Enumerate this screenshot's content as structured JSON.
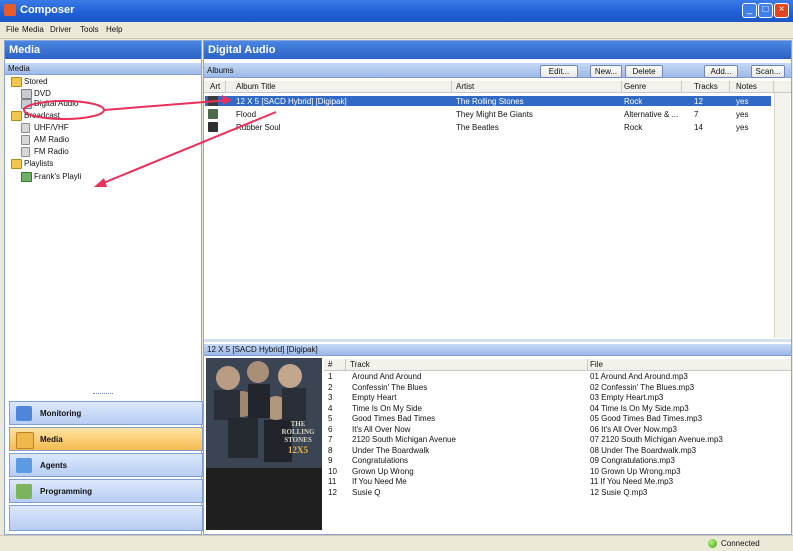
{
  "window": {
    "title": "Composer"
  },
  "menu": [
    "File",
    "Media",
    "Driver",
    "Tools",
    "Help"
  ],
  "left": {
    "header": "Media",
    "subheader": "Media",
    "tree": [
      {
        "label": "Stored",
        "icon": "folder-icon"
      },
      {
        "label": "DVD",
        "icon": "dvd-device-icon"
      },
      {
        "label": "Digital Audio",
        "icon": "digital-audio-device-icon"
      },
      {
        "label": "Broadcast",
        "icon": "folder-icon"
      },
      {
        "label": "UHF/VHF",
        "icon": "antenna-icon"
      },
      {
        "label": "AM Radio",
        "icon": "radio-icon"
      },
      {
        "label": "FM Radio",
        "icon": "radio-icon"
      },
      {
        "label": "Playlists",
        "icon": "folder-icon"
      },
      {
        "label": "Frank's Playli",
        "icon": "playlist-icon"
      }
    ],
    "nav": [
      {
        "label": "Monitoring",
        "active": false
      },
      {
        "label": "Media",
        "active": true
      },
      {
        "label": "Agents",
        "active": false
      },
      {
        "label": "Programming",
        "active": false
      }
    ]
  },
  "right": {
    "header": "Digital Audio",
    "albums_label": "Albums",
    "toolbar": {
      "edit": "Edit...",
      "new": "New...",
      "delete": "Delete",
      "add": "Add...",
      "scan": "Scan..."
    },
    "columns": [
      "Art",
      "Album Title",
      "Artist",
      "Genre",
      "Tracks",
      "Notes"
    ],
    "albums": [
      {
        "title": "12 X 5 [SACD Hybrid] [Digipak]",
        "artist": "The Rolling Stones",
        "genre": "Rock",
        "tracks": "12",
        "notes": "yes",
        "selected": true
      },
      {
        "title": "Flood",
        "artist": "They Might Be Giants",
        "genre": "Alternative & ...",
        "tracks": "7",
        "notes": "yes",
        "selected": false
      },
      {
        "title": "Rubber Soul",
        "artist": "The Beatles",
        "genre": "Rock",
        "tracks": "14",
        "notes": "yes",
        "selected": false
      }
    ],
    "detail_title": "12 X 5 [SACD Hybrid] [Digipak]",
    "track_columns": [
      "#",
      "Track",
      "File"
    ],
    "tracks": [
      {
        "n": "1",
        "track": "Around And Around",
        "file": "01 Around And Around.mp3"
      },
      {
        "n": "2",
        "track": "Confessin' The Blues",
        "file": "02 Confessin' The Blues.mp3"
      },
      {
        "n": "3",
        "track": "Empty Heart",
        "file": "03 Empty Heart.mp3"
      },
      {
        "n": "4",
        "track": "Time Is On My Side",
        "file": "04 Time Is On My Side.mp3"
      },
      {
        "n": "5",
        "track": "Good Times Bad Times",
        "file": "05 Good Times Bad Times.mp3"
      },
      {
        "n": "6",
        "track": "It's All Over Now",
        "file": "06 It's All Over Now.mp3"
      },
      {
        "n": "7",
        "track": "2120 South Michigan Avenue",
        "file": "07 2120 South Michigan Avenue.mp3"
      },
      {
        "n": "8",
        "track": "Under The Boardwalk",
        "file": "08 Under The Boardwalk.mp3"
      },
      {
        "n": "9",
        "track": "Congratulations",
        "file": "09 Congratulations.mp3"
      },
      {
        "n": "10",
        "track": "Grown Up Wrong",
        "file": "10 Grown Up Wrong.mp3"
      },
      {
        "n": "11",
        "track": "If You Need Me",
        "file": "11 If You Need Me.mp3"
      },
      {
        "n": "12",
        "track": "Susie Q",
        "file": "12 Susie Q.mp3"
      }
    ],
    "cover": {
      "line1": "THE",
      "line2": "ROLLING",
      "line3": "STONES",
      "line4": "12X5"
    }
  },
  "status": {
    "text": "Connected"
  },
  "colors": {
    "accent": "#2b62c6",
    "selection": "#3169c6",
    "annotation": "#e8315b",
    "active_nav": "#f6bb4f"
  }
}
